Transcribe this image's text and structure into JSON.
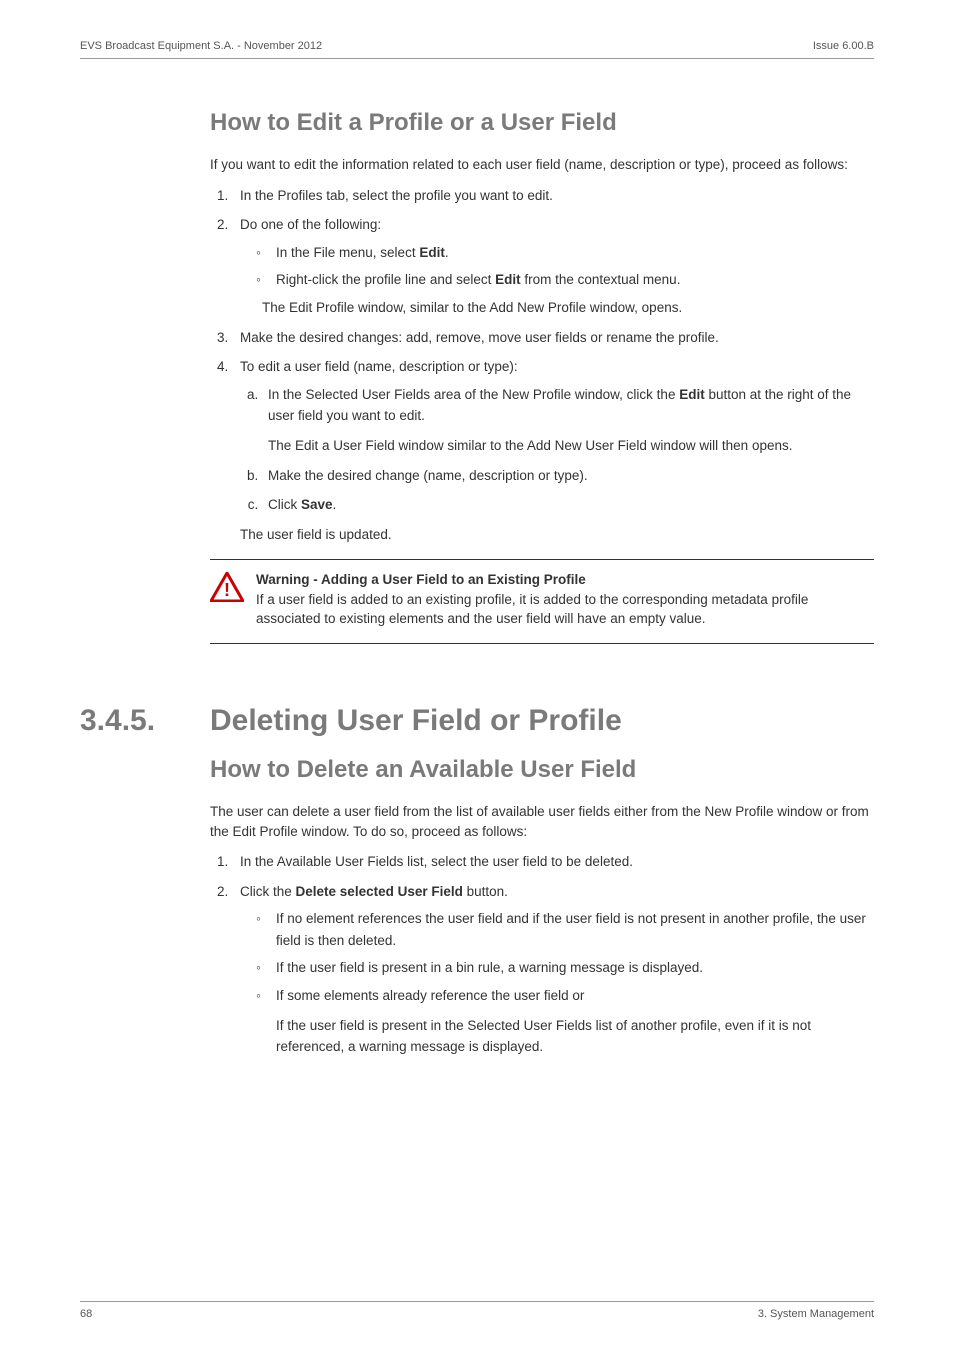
{
  "header": {
    "left": "EVS Broadcast Equipment S.A.  - November 2012",
    "right": "Issue 6.00.B"
  },
  "section1": {
    "title": "How to Edit a Profile or a User Field",
    "intro": "If you want to edit the information related to each user field (name, description or type), proceed as follows:",
    "step1": "In the Profiles tab, select the profile you want to edit.",
    "step2": "Do one of the following:",
    "step2a_pre": "In the File menu, select ",
    "step2a_bold": "Edit",
    "step2a_post": ".",
    "step2b_pre": "Right-click the profile line and select ",
    "step2b_bold": "Edit",
    "step2b_post": " from the contextual menu.",
    "step2_tail": "The Edit Profile window, similar to the Add New Profile window, opens.",
    "step3": "Make the desired changes: add, remove, move user fields or rename the profile.",
    "step4": "To edit a user field (name, description or type):",
    "step4a_pre": "In the Selected User Fields area of the New Profile window, click the ",
    "step4a_bold": "Edit",
    "step4a_post": " button at the right of the user field you want to edit.",
    "step4a_tail": "The Edit a User Field window similar to the Add New User Field window will then opens.",
    "step4b": "Make the desired change (name, description or type).",
    "step4c_pre": "Click ",
    "step4c_bold": "Save",
    "step4c_post": ".",
    "step4_tail": "The user field is updated."
  },
  "warning": {
    "title": "Warning - Adding a User Field to an Existing Profile",
    "body": "If a user field is added to an existing profile, it is added to the corresponding metadata profile associated to existing elements and the user field will have an empty value."
  },
  "section2": {
    "number": "3.4.5.",
    "heading": "Deleting User Field or Profile",
    "subtitle": "How to Delete an Available User Field",
    "intro": "The user can delete a user field from the list of available user fields either from the New Profile window or from the Edit Profile window. To do so, proceed as follows:",
    "step1": "In the Available User Fields list, select the user field to be deleted.",
    "step2_pre": "Click the ",
    "step2_bold": "Delete selected User Field",
    "step2_post": " button.",
    "b1": "If no element references the user field and if the user field is not present in another profile, the user field is then deleted.",
    "b2": "If the user field is present in a bin rule, a warning message is displayed.",
    "b3": "If some elements already reference the user field or",
    "b3_tail": "If the user field is present in the Selected User Fields list of another profile, even if it is not referenced, a warning message is displayed."
  },
  "footer": {
    "left": "68",
    "right": "3. System Management"
  }
}
